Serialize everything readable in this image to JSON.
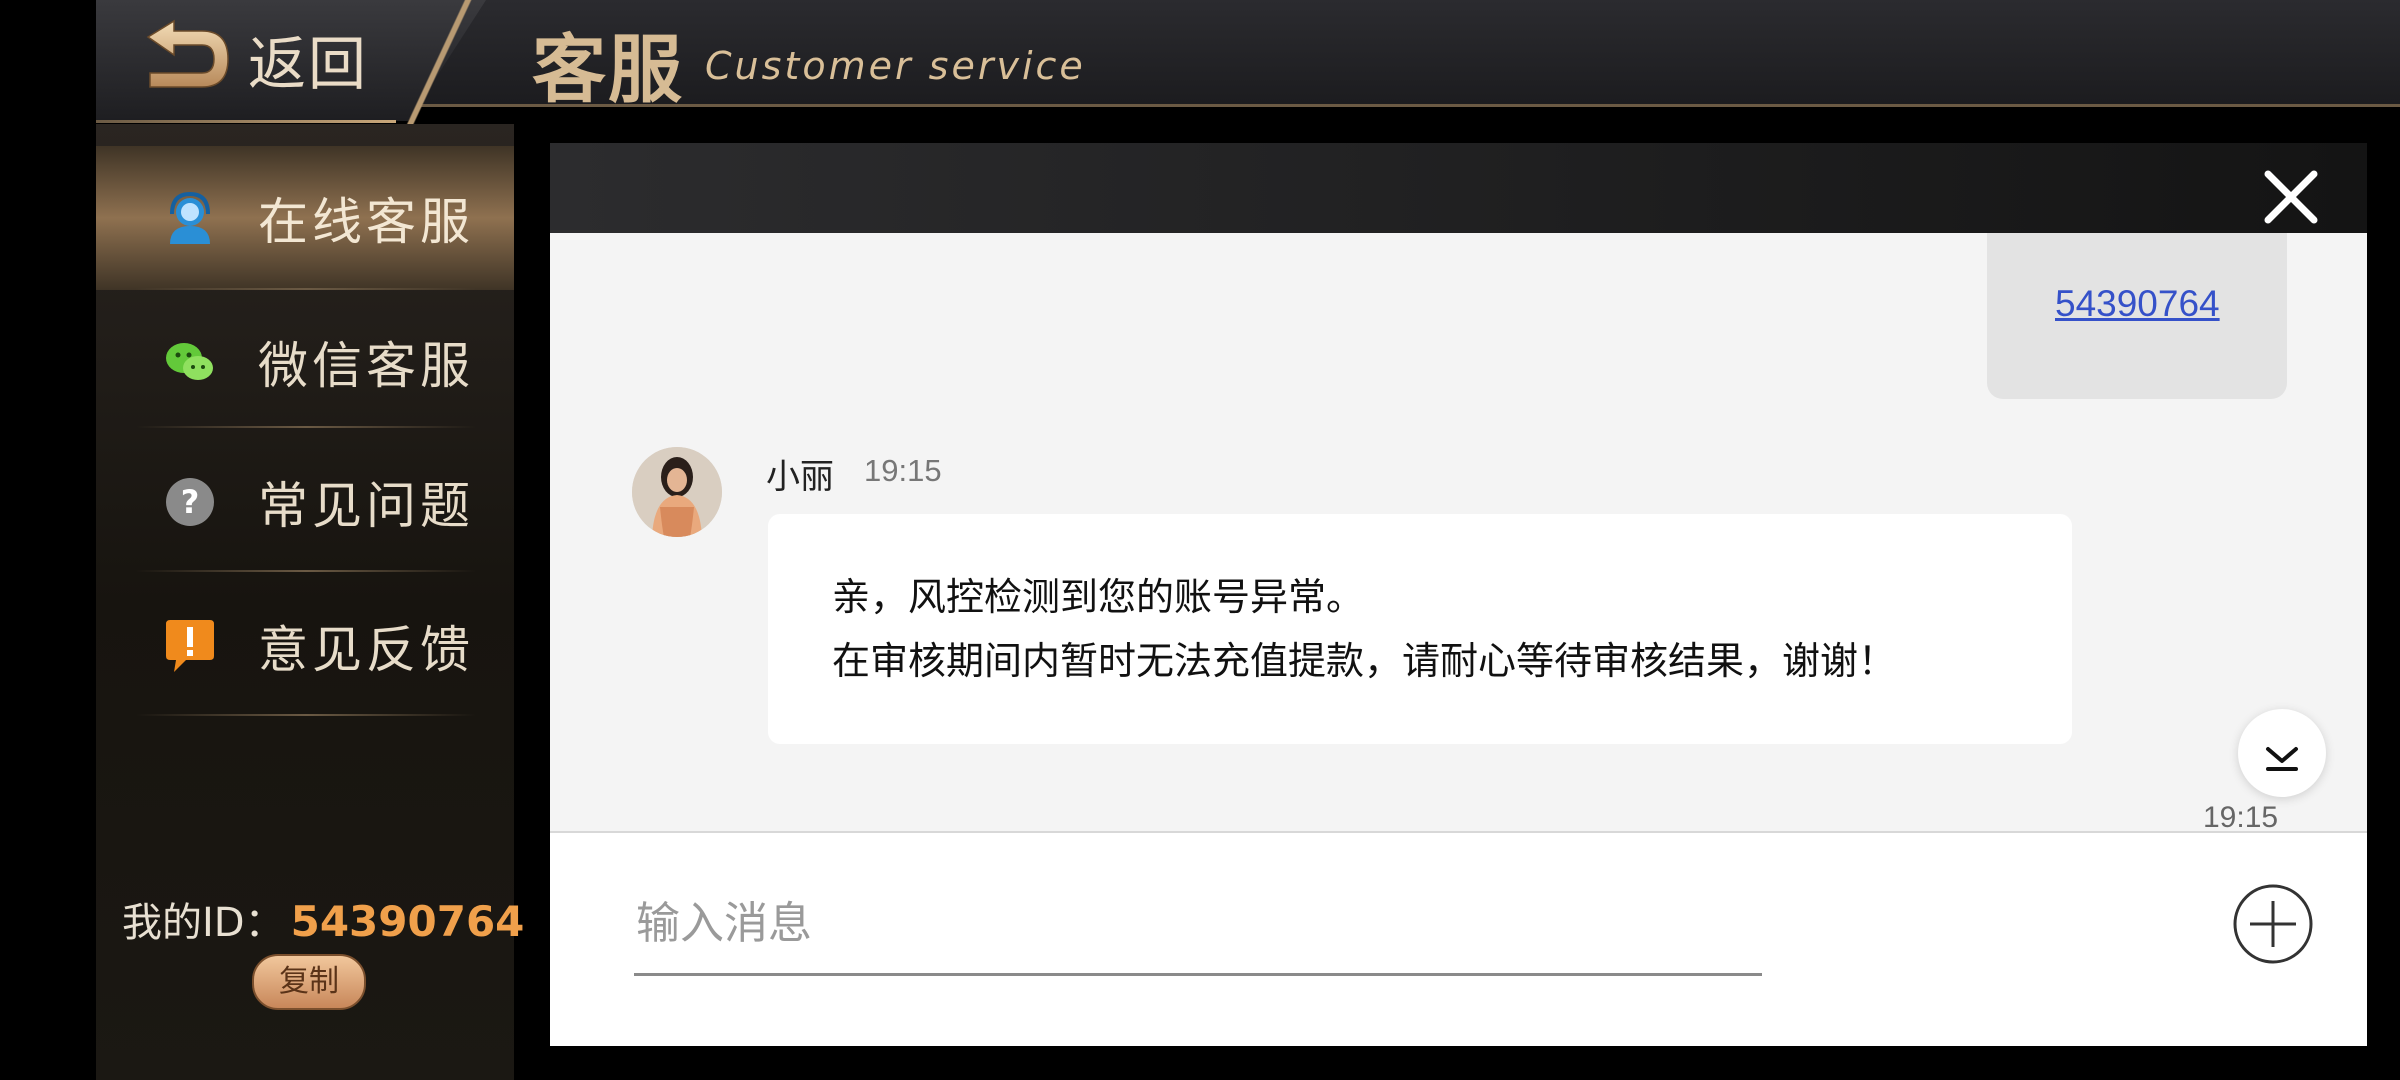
{
  "header": {
    "back_label": "返回",
    "title_cn": "客服",
    "title_en": "Customer service"
  },
  "sidebar": {
    "items": [
      {
        "label": "在线客服",
        "icon": "headset-user-icon"
      },
      {
        "label": "微信客服",
        "icon": "wechat-icon"
      },
      {
        "label": "常见问题",
        "icon": "question-icon"
      },
      {
        "label": "意见反馈",
        "icon": "feedback-exclamation-icon"
      }
    ],
    "my_id_label": "我的ID：",
    "my_id_value": "54390764",
    "copy_label": "复制"
  },
  "chat": {
    "sent_message": "54390764",
    "agent_name": "小丽",
    "agent_time": "19:15",
    "agent_message_line1": "亲，风控检测到您的账号异常。",
    "agent_message_line2": "在审核期间内暂时无法充值提款，请耐心等待审核结果，谢谢！",
    "bottom_time": "19:15"
  },
  "input": {
    "placeholder": "输入消息",
    "value": ""
  },
  "colors": {
    "accent_gold": "#d6bb94",
    "id_orange": "#f0a04b",
    "link_blue": "#3551c9"
  }
}
